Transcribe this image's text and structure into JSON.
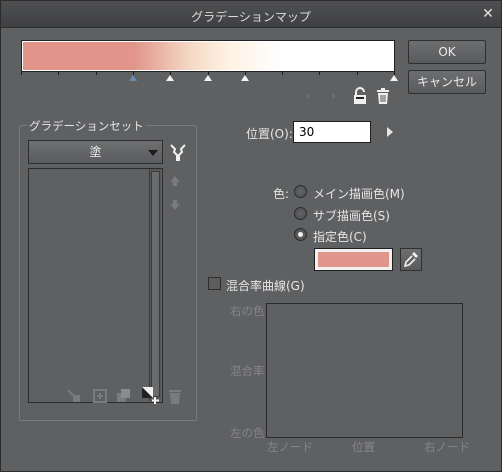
{
  "window": {
    "title": "グラデーションマップ",
    "close_label": "✕"
  },
  "gradient": {
    "stops": [
      {
        "color": "#e1958b",
        "position": 0.0
      },
      {
        "color": "#e1958b",
        "position": 0.3
      },
      {
        "color": "#f4d8c4",
        "position": 0.45
      },
      {
        "color": "#fdf1e2",
        "position": 0.55
      },
      {
        "color": "#ffffff",
        "position": 0.7
      },
      {
        "color": "#ffffff",
        "position": 1.0
      }
    ],
    "nodes": [
      0.3,
      0.4,
      0.5,
      0.6,
      1.0
    ],
    "selected_node": 0
  },
  "buttons": {
    "ok": "OK",
    "cancel": "キャンセル"
  },
  "node_nav": {
    "prev": "‹",
    "next": "›"
  },
  "gradient_set": {
    "title": "グラデーションセット",
    "selected": "塗",
    "items": []
  },
  "position": {
    "label": "位置(O):",
    "value": "30"
  },
  "color": {
    "label": "色:",
    "options": [
      {
        "label": "メイン描画色(M)",
        "selected": false
      },
      {
        "label": "サブ描画色(S)",
        "selected": false
      },
      {
        "label": "指定色(C)",
        "selected": true
      }
    ],
    "specified": "#e1958b"
  },
  "blend_curve": {
    "checkbox_label": "混合率曲線(G)",
    "checked": false,
    "y_top": "右の色",
    "y_mid": "混合率",
    "y_bottom": "左の色",
    "x_left": "左ノード",
    "x_mid": "位置",
    "x_right": "右ノード"
  },
  "colors": {
    "accent": "#6d8ab5",
    "panel": "#5f6062"
  }
}
